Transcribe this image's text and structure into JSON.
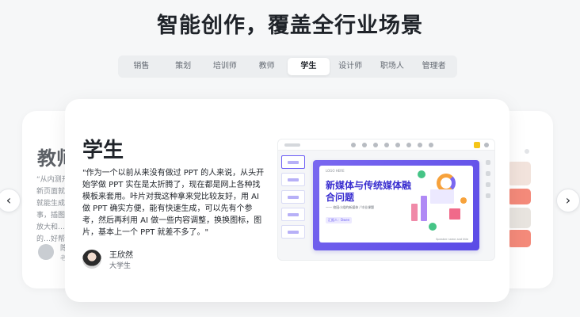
{
  "headline": "智能创作，覆盖全行业场景",
  "tabs": [
    {
      "label": "销售"
    },
    {
      "label": "策划"
    },
    {
      "label": "培训师"
    },
    {
      "label": "教师"
    },
    {
      "label": "学生",
      "active": true
    },
    {
      "label": "设计师"
    },
    {
      "label": "职场人"
    },
    {
      "label": "管理者"
    }
  ],
  "left_card": {
    "title": "教师",
    "quote": "“从内测开始…入新页面就…要、就能生成…省事，插图…自由放大和…育主题的…好帮手！”",
    "name": "陈",
    "role": "老"
  },
  "main_card": {
    "title": "学生",
    "quote": "\"作为一个以前从来没有做过 PPT 的人来说，从头开始学做 PPT 实在是太折腾了，现在都是网上各种找模板来套用。咔片对我这种拿来党比较友好，用 AI 做 PPT 确实方便，能有快速生成，可以先有个参考，然后再利用 AI 做一些内容调整，换换图标，图片，基本上一个 PPT 就差不多了。\"",
    "user_name": "王欣然",
    "user_role": "大学生"
  },
  "slide_preview": {
    "logo": "LOGO HERE",
    "title": "新媒体与传统媒体融合问题",
    "subtitle": "—— 校园小组的新媒体 / 毕业课题",
    "tag": "汇报人：Dwen",
    "footer": "Speaker name and title"
  },
  "colors": {
    "accent": "#6a5cf5",
    "slide_gradient_start": "#7a68f0",
    "slide_title": "#3a2fd0",
    "background": "#f6f7f8",
    "card": "#ffffff"
  },
  "icons": {
    "prev": "chevron-left-icon",
    "next": "chevron-right-icon"
  },
  "nav": {
    "prev_glyph": "‹",
    "next_glyph": "›"
  }
}
